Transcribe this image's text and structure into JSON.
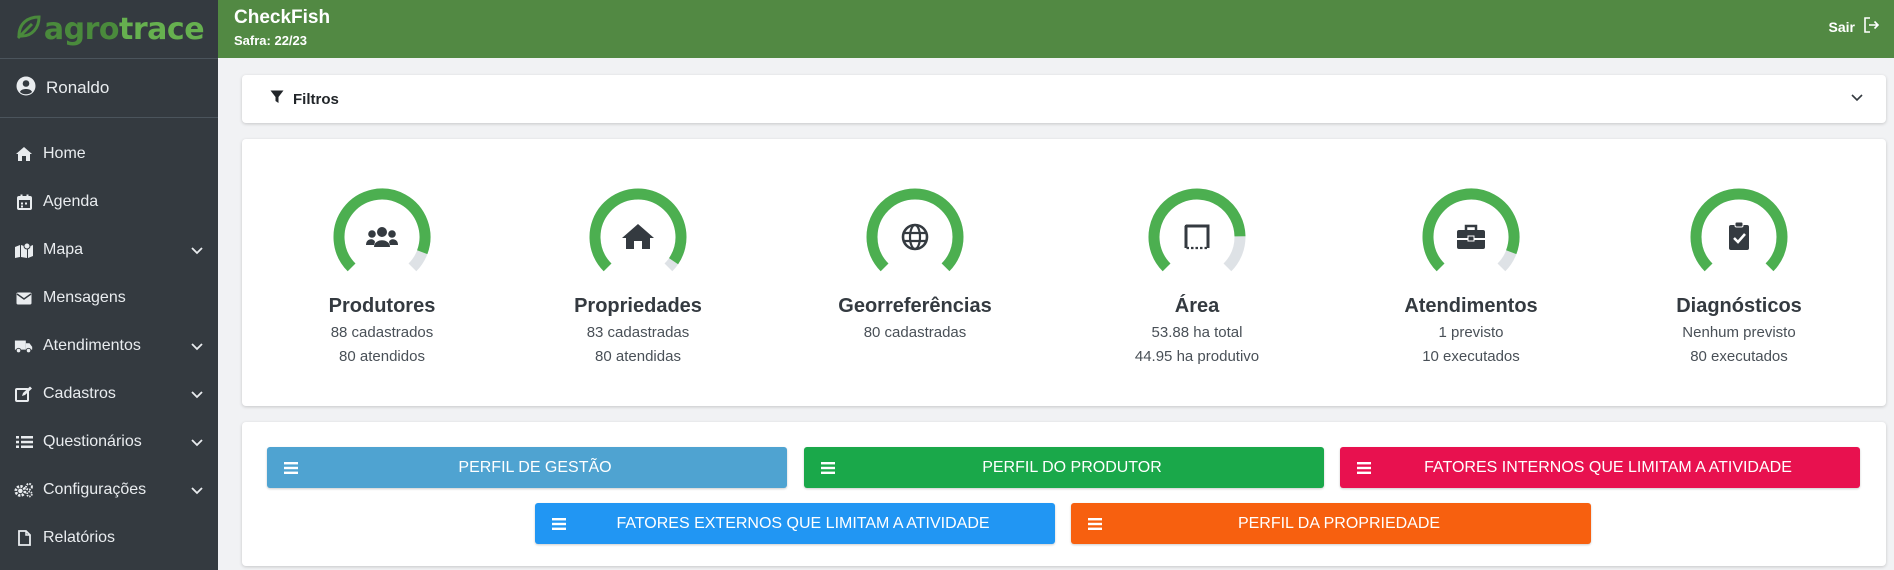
{
  "app": {
    "logo_part1": "agro",
    "logo_part2": "trace",
    "title": "CheckFish",
    "safra": "Safra: 22/23",
    "logout_label": "Sair"
  },
  "user": {
    "name": "Ronaldo"
  },
  "sidebar": {
    "items": [
      {
        "label": "Home",
        "icon": "home-icon",
        "expandable": false
      },
      {
        "label": "Agenda",
        "icon": "calendar-icon",
        "expandable": false
      },
      {
        "label": "Mapa",
        "icon": "map-icon",
        "expandable": true
      },
      {
        "label": "Mensagens",
        "icon": "envelope-icon",
        "expandable": false
      },
      {
        "label": "Atendimentos",
        "icon": "truck-icon",
        "expandable": true
      },
      {
        "label": "Cadastros",
        "icon": "edit-icon",
        "expandable": true
      },
      {
        "label": "Questionários",
        "icon": "list-icon",
        "expandable": true
      },
      {
        "label": "Configurações",
        "icon": "gears-icon",
        "expandable": true
      },
      {
        "label": "Relatórios",
        "icon": "file-icon",
        "expandable": false
      }
    ]
  },
  "filters": {
    "label": "Filtros"
  },
  "stats": [
    {
      "title": "Produtores",
      "line1": "88 cadastrados",
      "line2": "80 atendidos",
      "progress": 0.91,
      "icon": "users-icon"
    },
    {
      "title": "Propriedades",
      "line1": "83 cadastradas",
      "line2": "80 atendidas",
      "progress": 0.96,
      "icon": "house-icon"
    },
    {
      "title": "Georreferências",
      "line1": "80 cadastradas",
      "line2": "",
      "progress": 1.0,
      "icon": "globe-icon"
    },
    {
      "title": "Área",
      "line1": "53.88 ha total",
      "line2": "44.95 ha produtivo",
      "progress": 0.83,
      "icon": "area-icon"
    },
    {
      "title": "Atendimentos",
      "line1": "1 previsto",
      "line2": "10 executados",
      "progress": 0.91,
      "icon": "briefcase-icon"
    },
    {
      "title": "Diagnósticos",
      "line1": "Nenhum previsto",
      "line2": "80 executados",
      "progress": 1.0,
      "icon": "clipboard-check-icon"
    }
  ],
  "profiles": [
    {
      "label": "PERFIL DE GESTÃO",
      "color": "#4fa3d1"
    },
    {
      "label": "PERFIL DO PRODUTOR",
      "color": "#1aa84a"
    },
    {
      "label": "FATORES INTERNOS QUE LIMITAM A ATIVIDADE",
      "color": "#e8114f"
    },
    {
      "label": "FATORES EXTERNOS QUE LIMITAM A ATIVIDADE",
      "color": "#2196f3"
    },
    {
      "label": "PERFIL DA PROPRIEDADE",
      "color": "#f7600f"
    }
  ],
  "colors": {
    "sidebar": "#343a40",
    "header": "#528943",
    "ring": "#4caf50",
    "ring_track": "#dee2e6"
  }
}
